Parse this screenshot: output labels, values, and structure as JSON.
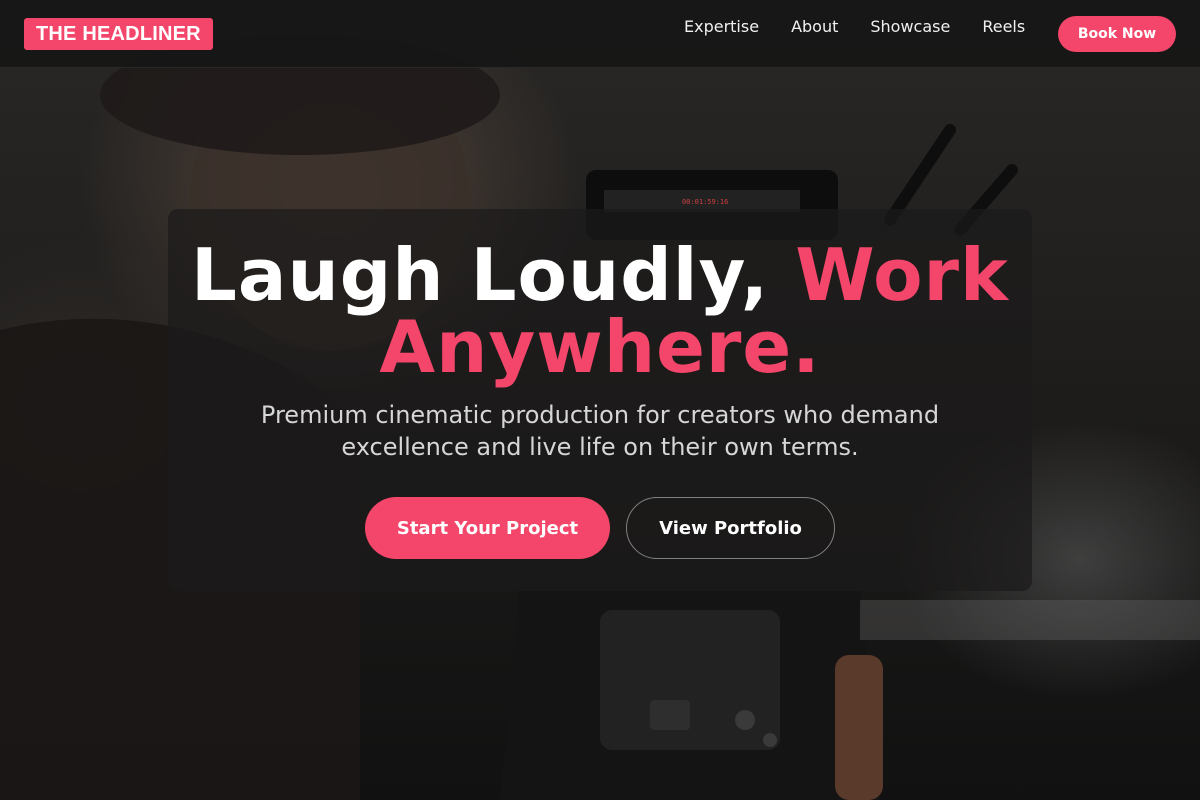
{
  "navbar": {
    "logo": "THE HEADLINER",
    "links": [
      "Expertise",
      "About",
      "Showcase",
      "Reels"
    ],
    "cta": "Book Now"
  },
  "hero": {
    "headline_part1": "Laugh Loudly, ",
    "headline_part2": "Work",
    "headline_part3": "Anywhere.",
    "subtitle": "Premium cinematic production for creators who demand excellence and live life on their own terms.",
    "primary_cta": "Start Your Project",
    "secondary_cta": "View Portfolio"
  },
  "monitor_readout": "00:01:59:16",
  "colors": {
    "accent": "#f3466a",
    "nav_bg": "#161616",
    "card_bg": "#1c1a1a"
  },
  "background_image": "camera-operator-photo"
}
